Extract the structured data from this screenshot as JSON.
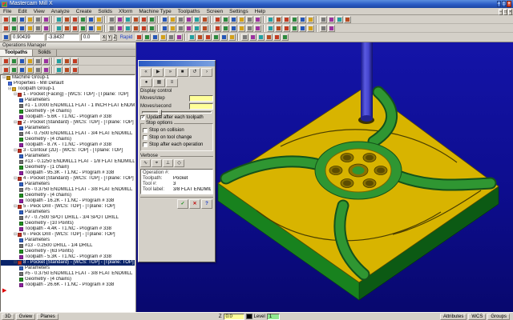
{
  "window": {
    "title": "Mastercam Mill X",
    "buttons": [
      "minimize",
      "maximize",
      "close"
    ]
  },
  "menu": {
    "items": [
      "File",
      "Edit",
      "View",
      "Analyze",
      "Create",
      "Solids",
      "Xform",
      "Machine Type",
      "Toolpaths",
      "Screen",
      "Settings",
      "Help"
    ]
  },
  "toolbars": {
    "row1_count": 40,
    "row2_count": 38,
    "ribbon_icon_count": 18,
    "ops_row1_count": 9,
    "ops_row2_count": 9
  },
  "icon_palette": [
    "#c23b22",
    "#2b8a3e",
    "#2456b8",
    "#d4a017",
    "#7a7a7a",
    "#9b30a0",
    "#20a0a0",
    "#b84a20"
  ],
  "ribbon": {
    "x_value": "0.90439",
    "y_value": "-3.8437",
    "z_value": "0.0",
    "axis_buttons": [
      "X",
      "Y",
      "Z"
    ],
    "rapid_label": "Rapid"
  },
  "ops_manager": {
    "title": "Operations Manager",
    "tabs": [
      {
        "label": "Toolpaths",
        "active": true
      },
      {
        "label": "Solids",
        "active": false
      }
    ],
    "tree": [
      [
        0,
        "machine",
        "Machine Group-1",
        false
      ],
      [
        1,
        "props",
        "Properties - Mill Default",
        false
      ],
      [
        1,
        "group",
        "Toolpath Group-1",
        false
      ],
      [
        2,
        "op",
        "1 - Pocket (Facing) - [WCS: TOP] - [Tplane: TOP]",
        false
      ],
      [
        3,
        "param",
        "Parameters",
        false
      ],
      [
        3,
        "tool",
        "#1 - 1.0000 ENDMILL1 FLAT - 1 INCH FLAT ENDMILL",
        false
      ],
      [
        3,
        "geom",
        "Geometry - (4 chains)",
        false
      ],
      [
        3,
        "tp",
        "Toolpath - 5.6K - T1.NC - Program # 338",
        false
      ],
      [
        2,
        "op",
        "2 - Pocket (Standard) - [WCS: TOP] - [Tplane: TOP]",
        false
      ],
      [
        3,
        "param",
        "Parameters",
        false
      ],
      [
        3,
        "tool",
        "#4 - 0.7500 ENDMILL1 FLAT - 3/4 FLAT ENDMILL",
        false
      ],
      [
        3,
        "geom",
        "Geometry - (4 chains)",
        false
      ],
      [
        3,
        "tp",
        "Toolpath - 8.7K - T1.NC - Program # 338",
        false
      ],
      [
        2,
        "op",
        "3 - Contour (2D) - [WCS: TOP] - [Tplane: TOP]",
        false
      ],
      [
        3,
        "param",
        "Parameters",
        false
      ],
      [
        3,
        "tool",
        "#13 - 0.1250 ENDMILL1 FLAT - 1/8 FLAT ENDMILL",
        false
      ],
      [
        3,
        "geom",
        "Geometry - (1 chain)",
        false
      ],
      [
        3,
        "tp",
        "Toolpath - 95.3K - T1.NC - Program # 338",
        false
      ],
      [
        2,
        "op",
        "4 - Pocket (Standard) - [WCS: TOP] - [Tplane: TOP]",
        false
      ],
      [
        3,
        "param",
        "Parameters",
        false
      ],
      [
        3,
        "tool",
        "#5 - 0.3750 ENDMILL1 FLAT - 3/8 FLAT ENDMILL",
        false
      ],
      [
        3,
        "geom",
        "Geometry - (4 chains)",
        false
      ],
      [
        3,
        "tp",
        "Toolpath - 16.2K - T1.NC - Program # 338",
        false
      ],
      [
        2,
        "op",
        "5 - Peck Drill - [WCS: TOP] - [Tplane: TOP]",
        false
      ],
      [
        3,
        "param",
        "Parameters",
        false
      ],
      [
        3,
        "tool",
        "#7 - 0.7500 SPOT DRILL - 3/4 SPOT DRILL",
        false
      ],
      [
        3,
        "geom",
        "Geometry - (10 Points)",
        false
      ],
      [
        3,
        "tp",
        "Toolpath - 4.4K - T1.NC - Program # 338",
        false
      ],
      [
        2,
        "op",
        "6 - Peck Drill - [WCS: TOP] - [Tplane: TOP]",
        false
      ],
      [
        3,
        "param",
        "Parameters",
        false
      ],
      [
        3,
        "tool",
        "#13 - 0.2500 DRILL - 1/4 DRILL",
        false
      ],
      [
        3,
        "geom",
        "Geometry - (63 Points)",
        false
      ],
      [
        3,
        "tp",
        "Toolpath - 5.3K - T1.NC - Program # 338",
        false
      ],
      [
        2,
        "op",
        "8 - Pocket (Standard) - [WCS: TOP] - [Tplane: TOP]",
        true
      ],
      [
        3,
        "param",
        "Parameters",
        false
      ],
      [
        3,
        "tool",
        "#5 - 0.3750 ENDMILL1 FLAT - 3/8 FLAT ENDMILL",
        false
      ],
      [
        3,
        "geom",
        "Geometry - (4 chains)",
        false
      ],
      [
        3,
        "tp",
        "Toolpath - 26.6K - T1.NC - Program # 338",
        false
      ]
    ]
  },
  "dialog": {
    "vcr_buttons": [
      "rewind",
      "play",
      "fast-forward",
      "stop",
      "restart",
      "step"
    ],
    "mode_buttons": [
      "backplot-run",
      "save-geometry",
      "details"
    ],
    "display_control_label": "Display control",
    "moves_step_label": "Moves/step",
    "moves_step_value": "",
    "moves_second_label": "Moves/second",
    "moves_second_value": "",
    "update_checkbox_label": "Update after each toolpath",
    "update_checked": true,
    "stop_options_label": "Stop options",
    "stop_checkboxes": [
      "Stop on collision",
      "Stop on tool change",
      "Stop after each operation"
    ],
    "verbose_label": "Verbose",
    "verbose_buttons": [
      "trace",
      "coords",
      "tool-display",
      "wireframe"
    ],
    "info": [
      {
        "label": "Operation #:",
        "value": ""
      },
      {
        "label": "Toolpath:",
        "value": "Pocket"
      },
      {
        "label": "Tool #:",
        "value": "3"
      },
      {
        "label": "Tool label:",
        "value": "3/8 FLAT ENDMILL"
      }
    ],
    "bottom_buttons": [
      "ok",
      "cancel",
      "help"
    ]
  },
  "statusbar": {
    "threed": "3D",
    "gview": "Gview",
    "planes": "Planes",
    "z_label": "Z",
    "z_value": "0.0",
    "level_label": "Level",
    "level_value": "1",
    "attributes": "Attributes",
    "wcs": "WCS",
    "groups": "Groups"
  },
  "colors": {
    "part_yellow": "#d8b400",
    "pocket_green": "#2f9632",
    "pocket_green_dark": "#14521a",
    "side_green": "#18821e",
    "side_green_dark": "#0c5a14",
    "tool_blue": "#4646d0",
    "viewport_navy": "#0d0d8e"
  }
}
